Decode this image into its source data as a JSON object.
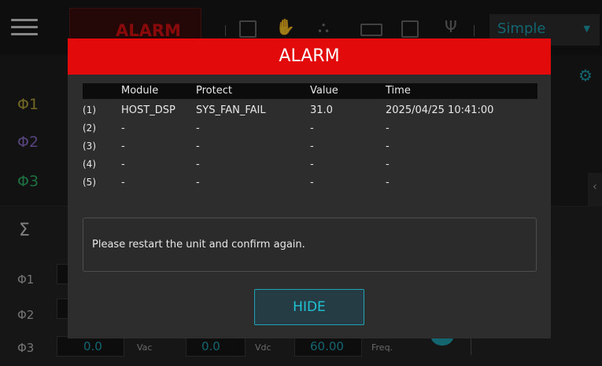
{
  "topbar": {
    "alarm_tab_label": "ALARM",
    "mode_select_value": "Simple"
  },
  "left_panel": {
    "phases": [
      "Φ1",
      "Φ2",
      "Φ3"
    ],
    "sum_label": "Σ"
  },
  "bottom_panel": {
    "phases": [
      "Φ1",
      "Φ2",
      "Φ3"
    ],
    "row3": {
      "value1": "0.0",
      "unit1": "Vac",
      "value2": "0.0",
      "unit2": "Vdc",
      "value3": "60.00",
      "unit3": "Freq."
    }
  },
  "dialog": {
    "title": "ALARM",
    "columns": [
      "Module",
      "Protect",
      "Value",
      "Time"
    ],
    "rows": [
      {
        "index": "(1)",
        "module": "HOST_DSP",
        "protect": "SYS_FAN_FAIL",
        "value": "31.0",
        "time": "2025/04/25 10:41:00"
      },
      {
        "index": "(2)",
        "module": "-",
        "protect": "-",
        "value": "-",
        "time": "-"
      },
      {
        "index": "(3)",
        "module": "-",
        "protect": "-",
        "value": "-",
        "time": "-"
      },
      {
        "index": "(4)",
        "module": "-",
        "protect": "-",
        "value": "-",
        "time": "-"
      },
      {
        "index": "(5)",
        "module": "-",
        "protect": "-",
        "value": "-",
        "time": "-"
      }
    ],
    "message": "Please restart the unit and confirm again.",
    "hide_label": "HIDE"
  },
  "colors": {
    "accent": "#1fa3b5",
    "alarm_red": "#e20a0a",
    "phase1": "#b9a83a",
    "phase2": "#8d6fc9",
    "phase3": "#2fb36a"
  }
}
